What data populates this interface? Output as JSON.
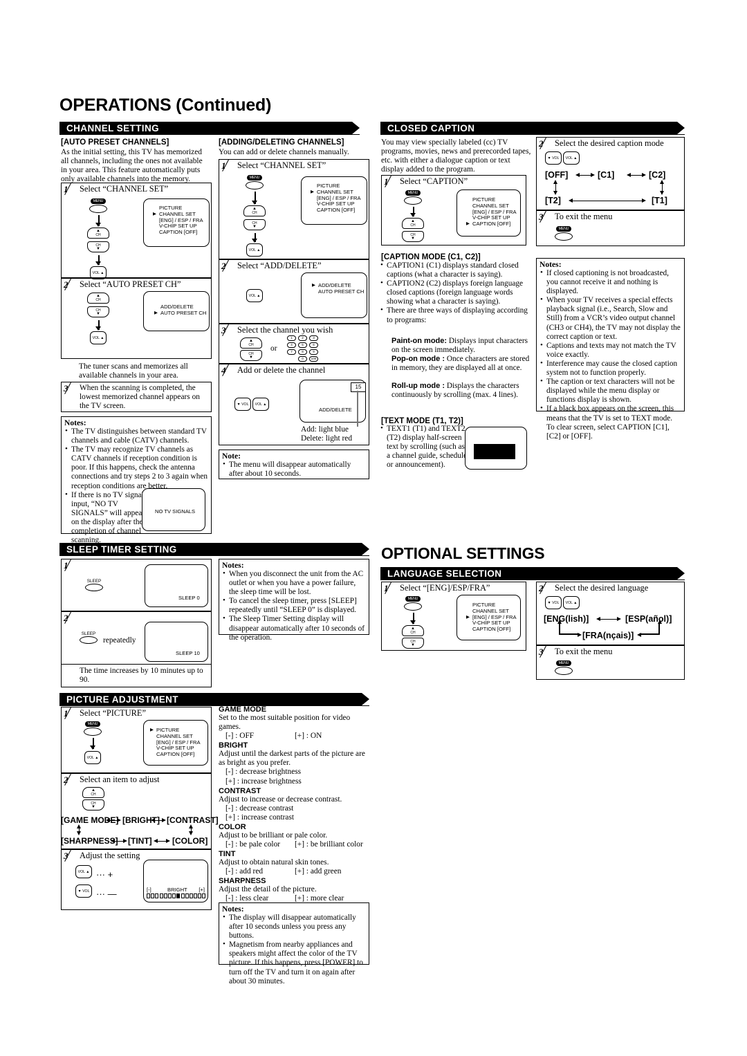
{
  "page": {
    "title": "OPERATIONS (Continued)",
    "optional_title": "OPTIONAL SETTINGS"
  },
  "sections": {
    "channel_setting": {
      "heading": "CHANNEL SETTING"
    },
    "closed_caption": {
      "heading": "CLOSED CAPTION"
    },
    "sleep_timer": {
      "heading": "SLEEP TIMER SETTING"
    },
    "language_selection": {
      "heading": "LANGUAGE SELECTION"
    },
    "picture_adjustment": {
      "heading": "PICTURE ADJUSTMENT"
    }
  },
  "auto_preset": {
    "heading": "[AUTO PRESET CHANNELS]",
    "intro": "As the initial setting, this TV has memorized all channels, including the ones not available in your area. This feature automatically puts only available channels into the memory.",
    "step1_num": "1",
    "step1_text": "Select “CHANNEL SET”",
    "step2_num": "2",
    "step2_text": "Select “AUTO PRESET CH”",
    "step2_note": "The tuner scans and memorizes all available channels in your area.",
    "step3_num": "3",
    "step3_text": "When the scanning is completed, the lowest memorized channel appears on the TV screen.",
    "menu1": [
      "PICTURE",
      "CHANNEL SET",
      "[ENG] / ESP / FRA",
      "V-CHIP SET UP",
      "CAPTION [OFF]"
    ],
    "menu1_pointer_index": 1,
    "menu2": [
      "ADD/DELETE",
      "AUTO PRESET CH"
    ],
    "menu2_pointer_index": 1,
    "notes_heading": "Notes:",
    "notes": [
      "The TV distinguishes between standard TV channels and cable (CATV) channels.",
      "The TV may recognize TV channels as CATV channels if reception condition is poor. If this happens, check the antenna connections and try steps 2 to 3 again when reception conditions are better.",
      "If there is no TV signal input, “NO TV SIGNALS” will appear on the display after the completion of channel scanning."
    ],
    "no_signal_screen": "NO TV SIGNALS"
  },
  "add_delete": {
    "heading": "[ADDING/DELETING CHANNELS]",
    "intro": "You can add or delete channels manually.",
    "step1_num": "1",
    "step1_text": "Select “CHANNEL SET”",
    "step2_num": "2",
    "step2_text": "Select “ADD/DELETE”",
    "step3_num": "3",
    "step3_text": "Select the channel you wish",
    "step3_or": "or",
    "step4_num": "4",
    "step4_text": "Add or delete the channel",
    "menu1": [
      "PICTURE",
      "CHANNEL SET",
      "[ENG] / ESP / FRA",
      "V-CHIP SET UP",
      "CAPTION [OFF]"
    ],
    "menu1_pointer_index": 1,
    "menu2": [
      "ADD/DELETE",
      "AUTO PRESET CH"
    ],
    "menu2_pointer_index": 0,
    "keypad": [
      "1",
      "2",
      "3",
      "4",
      "5",
      "6",
      "7",
      "8",
      "9",
      "0",
      "100"
    ],
    "screen_label": "ADD/DELETE",
    "channel_number": "15",
    "legend_add": "Add: light blue",
    "legend_delete": "Delete: light red",
    "note_heading": "Note:",
    "notes": [
      "The menu will disappear automatically after about 10 seconds."
    ]
  },
  "closed_caption": {
    "intro": "You may view specially labeled (cc) TV programs, movies, news and prerecorded tapes, etc. with either a dialogue caption or text display added to the program.",
    "step1_num": "1",
    "step1_text": "Select “CAPTION”",
    "menu1": [
      "PICTURE",
      "CHANNEL SET",
      "[ENG] / ESP / FRA",
      "V-CHIP SET UP",
      "CAPTION [OFF]"
    ],
    "menu1_pointer_index": 4,
    "step2_num": "2",
    "step2_text": "Select the desired caption mode",
    "modes": [
      "[OFF]",
      "[C1]",
      "[C2]",
      "[T2]",
      "[T1]"
    ],
    "step3_num": "3",
    "step3_text": "To exit the menu",
    "caption_mode_heading": "[CAPTION MODE (C1, C2)]",
    "caption_mode_notes": [
      "CAPTION1 (C1) displays standard closed captions (what a character is saying).",
      "CAPTION2 (C2) displays foreign language closed captions (foreign language words showing what a character is saying).",
      "There are three ways of displaying according to programs:"
    ],
    "display_modes": [
      {
        "term": "Paint-on mode:",
        "desc": "Displays input characters on the screen immediately."
      },
      {
        "term": "Pop-on mode  :",
        "desc": "Once characters are stored in memory, they are displayed all at once."
      },
      {
        "term": "Roll-up mode :",
        "desc": "Displays the characters continuously by scrolling (max. 4 lines)."
      }
    ],
    "text_mode_heading": "[TEXT MODE (T1, T2)]",
    "text_mode_note": "TEXT1 (T1) and TEXT2 (T2) display half-screen text by scrolling (such as a channel guide, schedule or announcement).",
    "notes_heading": "Notes:",
    "notes": [
      "If closed captioning is not broadcasted, you cannot receive it and nothing is displayed.",
      "When your TV receives a special effects playback signal (i.e., Search, Slow and Still) from a VCR’s video output channel (CH3 or CH4), the TV may not display the correct caption or text.",
      "Captions and texts may not match the TV voice exactly.",
      "Interference may cause the closed caption system not to function properly.",
      "The caption or text characters will not be displayed while the menu display or functions display is shown.",
      "If a black box appears on the screen, this means that the TV is set to TEXT mode. To clear screen, select CAPTION [C1], [C2] or [OFF]."
    ]
  },
  "sleep_timer": {
    "step1_num": "1",
    "step2_num": "2",
    "button_label": "SLEEP",
    "repeatedly": "repeatedly",
    "screen1": "SLEEP 0",
    "screen2": "SLEEP 10",
    "footnote": "The time increases by 10 minutes up to 90.",
    "notes_heading": "Notes:",
    "notes": [
      "When you disconnect the unit from the AC outlet or when you have a power failure, the sleep time will be lost.",
      "To cancel the sleep timer, press [SLEEP] repeatedly until “SLEEP 0” is displayed.",
      "The Sleep Timer Setting display will disappear automatically after 10 seconds of the operation."
    ]
  },
  "language": {
    "step1_num": "1",
    "step1_text": "Select “[ENG]/ESP/FRA”",
    "menu1": [
      "PICTURE",
      "CHANNEL SET",
      "[ENG] / ESP / FRA",
      "V-CHIP SET UP",
      "CAPTION [OFF]"
    ],
    "menu1_pointer_index": 2,
    "step2_num": "2",
    "step2_text": "Select the desired language",
    "options": [
      "[ENG(lish)]",
      "[ESP(añol)]",
      "[FRA(nçais)]"
    ],
    "step3_num": "3",
    "step3_text": "To exit the menu"
  },
  "picture": {
    "step1_num": "1",
    "step1_text": "Select “PICTURE”",
    "menu1": [
      "PICTURE",
      "CHANNEL SET",
      "[ENG] / ESP / FRA",
      "V-CHIP SET UP",
      "CAPTION  [OFF]"
    ],
    "menu1_pointer_index": 0,
    "step2_num": "2",
    "step2_text": "Select an item to adjust",
    "items": [
      "[GAME MODE]",
      "[BRIGHT]",
      "[CONTRAST]",
      "[SHARPNESS]",
      "[TINT]",
      "[COLOR]"
    ],
    "step3_num": "3",
    "step3_text": "Adjust the setting",
    "plus_hint": "···  +",
    "minus_hint": "···  —",
    "bar_minus": "[-]",
    "bar_plus": "[+]",
    "bar_label": "BRIGHT",
    "bar_cells": 16,
    "bar_filled_index": 7,
    "descriptions": [
      {
        "term": "GAME MODE",
        "text": "Set to the most suitable position for video games.",
        "minus": "[-] : OFF",
        "plus": "[+] : ON",
        "inline": true
      },
      {
        "term": "BRIGHT",
        "text": "Adjust until the darkest parts of the picture are as bright as you prefer.",
        "minus": "[-] : decrease brightness",
        "plus": "[+] : increase brightness",
        "inline": false
      },
      {
        "term": "CONTRAST",
        "text": "Adjust to increase or decrease contrast.",
        "minus": "[-] : decrease contrast",
        "plus": "[+] : increase contrast",
        "inline": false
      },
      {
        "term": "COLOR",
        "text": "Adjust to be brilliant or pale color.",
        "minus": "[-] : be pale color",
        "plus": "[+] : be brilliant color",
        "inline": true
      },
      {
        "term": "TINT",
        "text": "Adjust to obtain natural skin tones.",
        "minus": "[-] : add red",
        "plus": "[+] : add green",
        "inline": true
      },
      {
        "term": "SHARPNESS",
        "text": "Adjust the detail of the picture.",
        "minus": "[-] : less clear",
        "plus": "[+] : more clear",
        "inline": true
      }
    ],
    "notes_heading": "Notes:",
    "notes": [
      "The display will disappear automatically after 10 seconds unless you press any buttons.",
      "Magnetism from nearby appliances and speakers might affect the color of the TV picture. If this happens, press [POWER] to turn off the TV and turn it on again after about 30 minutes."
    ]
  },
  "buttons": {
    "menu": "MENU",
    "ch": "CH",
    "vol_up": "VOL ▲",
    "vol_down": "▼ VOL",
    "sleep": "SLEEP"
  }
}
